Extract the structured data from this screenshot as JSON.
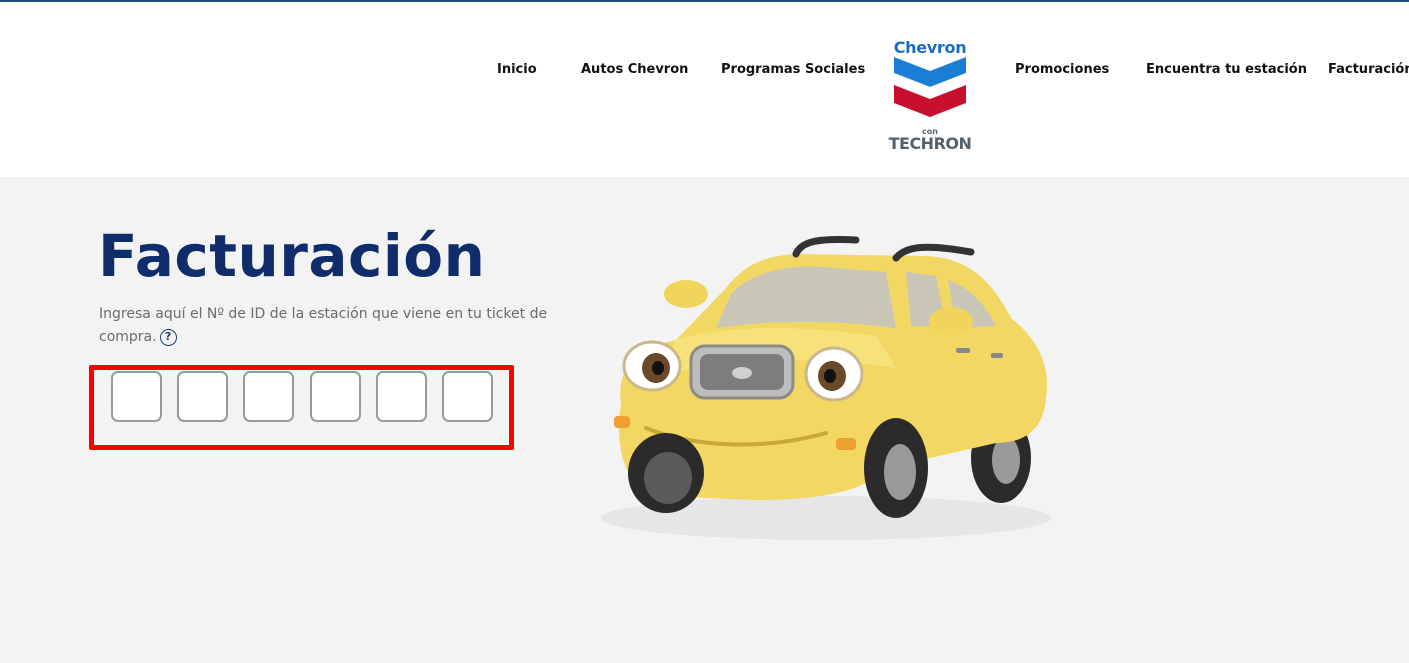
{
  "header": {
    "nav": {
      "inicio": "Inicio",
      "autos": "Autos Chevron",
      "programas": "Programas Sociales",
      "promociones": "Promociones",
      "estacion": "Encuentra tu estación",
      "facturacion": "Facturación"
    },
    "logo": {
      "brand": "Chevron",
      "con": "con",
      "techron": "TECHRON"
    }
  },
  "main": {
    "title": "Facturación",
    "instructions": "Ingresa aquí el Nº de ID de la estación que viene en tu ticket de compra.",
    "help_symbol": "?",
    "station_id_digits": [
      "",
      "",
      "",
      "",
      "",
      ""
    ]
  },
  "colors": {
    "title": "#0f2d6b",
    "highlight": "#ff0000",
    "chevron_blue": "#1a6fc4",
    "chevron_red": "#c8102e"
  },
  "icons": {
    "help": "question-circle-icon",
    "car": "cartoon-car-illustration"
  }
}
